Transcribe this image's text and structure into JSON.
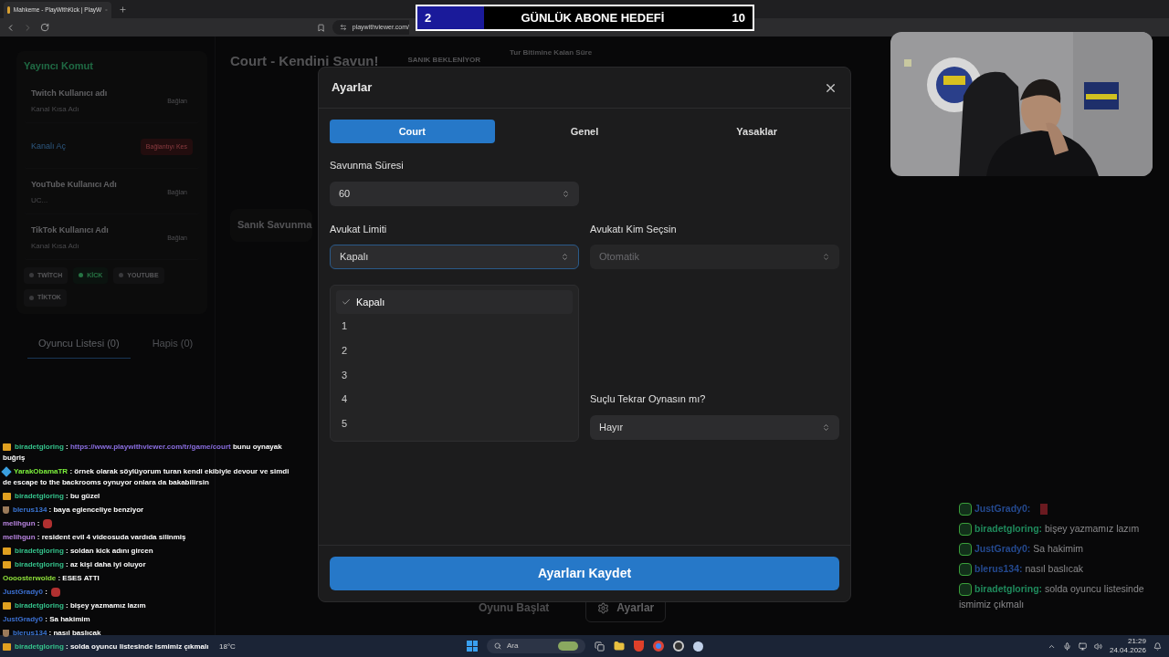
{
  "browser": {
    "tab_title": "Mahkeme - PlayWithKick | PlayW",
    "url": "playwithviewer.com/"
  },
  "goal": {
    "current": "2",
    "title": "GÜNLÜK ABONE HEDEFİ",
    "target": "10",
    "level": 0.2
  },
  "sidebar": {
    "title": "Yayıncı Komut",
    "accounts": [
      {
        "kind": "connect",
        "label": "Twitch Kullanıcı adı",
        "value": "Kanal Kısa Adı",
        "button": "Bağlan"
      },
      {
        "kind": "disconnect",
        "label": "Kanalı Aç",
        "button": "Bağlantıyı Kes"
      },
      {
        "kind": "connect",
        "label": "YouTube Kullanıcı Adı",
        "value": "UC...",
        "button": "Bağlan"
      },
      {
        "kind": "connect",
        "label": "TikTok Kullanıcı Adı",
        "value": "Kanal Kısa Adı",
        "button": "Bağlan"
      }
    ],
    "platforms": [
      {
        "label": "TWİTCH",
        "selected": false
      },
      {
        "label": "KİCK",
        "selected": true
      },
      {
        "label": "YOUTUBE",
        "selected": false
      },
      {
        "label": "TİKTOK",
        "selected": false
      }
    ],
    "tabs": [
      {
        "label": "Oyuncu Listesi (0)",
        "selected": true
      },
      {
        "label": "Hapis (0)",
        "selected": false
      }
    ]
  },
  "main": {
    "title": "Court - Kendini Savun!",
    "status": "SANIK BEKLENİYOR",
    "timer_label": "Tur Bitimine Kalan Süre",
    "section": "Sanık Savunma",
    "start_button": "Oyunu Başlat",
    "settings_button": "Ayarlar"
  },
  "modal": {
    "title": "Ayarlar",
    "tabs": [
      {
        "label": "Court",
        "selected": true
      },
      {
        "label": "Genel",
        "selected": false
      },
      {
        "label": "Yasaklar",
        "selected": false
      }
    ],
    "defense_time": {
      "label": "Savunma Süresi",
      "value": "60"
    },
    "lawyer_limit": {
      "label": "Avukat Limiti",
      "value": "Kapalı",
      "expanded": true,
      "options": [
        {
          "label": "Kapalı",
          "selected": true
        },
        {
          "label": "1",
          "selected": false
        },
        {
          "label": "2",
          "selected": false
        },
        {
          "label": "3",
          "selected": false
        },
        {
          "label": "4",
          "selected": false
        },
        {
          "label": "5",
          "selected": false
        }
      ]
    },
    "lawyer_chooser": {
      "label": "Avukatı Kim Seçsin",
      "placeholder": "Otomatik"
    },
    "replay": {
      "label": "Suçlu Tekrar Oynasın mı?",
      "value": "Hayır"
    },
    "save_button": "Ayarları Kaydet"
  },
  "chat_left": [
    {
      "kind": "crown",
      "user": "biradetgloring",
      "color": "#34c08a",
      "separator": ":",
      "link": "https://www.playwithviewer.com/tr/game/court",
      "text": "bunu oynayak buğriş"
    },
    {
      "kind": "cube",
      "user": "YarakObamaTR",
      "color": "#7cf03c",
      "text": ": örnek olarak söylüyorum turan kendi ekibiyle devour ve simdi de escape to the backrooms oynuyor onlara da bakabilirsin"
    },
    {
      "kind": "crown",
      "user": "biradetgloring",
      "color": "#34c08a",
      "text": ": bu güzel"
    },
    {
      "kind": "shield",
      "user": "blerus134",
      "color": "#3b76d6",
      "text": ": baya eglenceliye benziyor"
    },
    {
      "kind": "emote",
      "user": "melihgun",
      "color": "#b884e0",
      "text": ":"
    },
    {
      "user": "melihgun",
      "color": "#b884e0",
      "text": ": resident evil 4 videosuda vardıda silinmiş"
    },
    {
      "kind": "crown",
      "user": "biradetgloring",
      "color": "#34c08a",
      "text": ": soldan kick adını gircen"
    },
    {
      "kind": "crown",
      "user": "biradetgloring",
      "color": "#34c08a",
      "text": ": az kişi daha iyi oluyor"
    },
    {
      "user": "Oooosterwolde",
      "color": "#8ee03a",
      "text": ": ESES ATTI"
    },
    {
      "kind": "emote",
      "user": "JustGrady0",
      "color": "#3b6fd0",
      "text": ":"
    },
    {
      "kind": "crown",
      "user": "biradetgloring",
      "color": "#34c08a",
      "text": ": bişey yazmamız lazım"
    },
    {
      "user": "JustGrady0",
      "color": "#3b6fd0",
      "text": ": Sa hakimim"
    },
    {
      "kind": "shield",
      "user": "blerus134",
      "color": "#3b76d6",
      "text": ": nasıl baslıcak"
    },
    {
      "kind": "crown",
      "user": "biradetgloring",
      "color": "#34c08a",
      "text": ": solda oyuncu listesinde ismimiz çıkmalı"
    }
  ],
  "chat_right": [
    {
      "kind": "emote",
      "user": "JustGrady0:",
      "color": "#24498f"
    },
    {
      "user": "biradetgloring:",
      "color": "#1f8a5c",
      "text": "bişey yazmamız lazım"
    },
    {
      "user": "JustGrady0:",
      "color": "#24498f",
      "text": "Sa hakimim"
    },
    {
      "user": "blerus134:",
      "color": "#24498f",
      "text": "nasıl baslıcak"
    },
    {
      "user": "biradetgloring:",
      "color": "#1f8a5c",
      "text": "solda oyuncu listesinde ismimiz çıkmalı"
    }
  ],
  "taskbar": {
    "weather": "18°C",
    "search_placeholder": "Ara",
    "time": "21:29",
    "date": "24.04.2026"
  }
}
